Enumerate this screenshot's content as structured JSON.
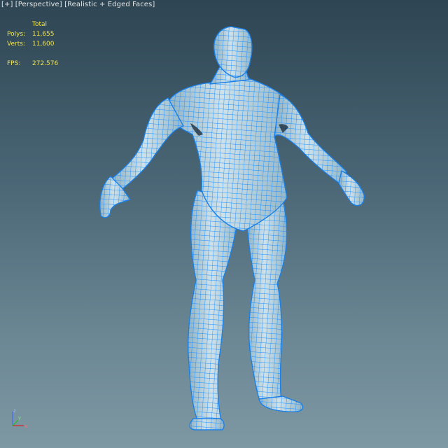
{
  "viewport": {
    "label_plus": "[+]",
    "label_view": "[Perspective]",
    "label_shading": "[Realistic + Edged Faces]"
  },
  "stats": {
    "column_header": "Total",
    "polys_label": "Polys:",
    "polys_value": "11,655",
    "verts_label": "Verts:",
    "verts_value": "11,600",
    "fps_label": "FPS:",
    "fps_value": "272.576"
  },
  "axis_gizmo": {
    "x_label": "x",
    "y_label": "y",
    "z_label": "z"
  },
  "colors": {
    "mesh_fill": "#b9d4e0",
    "mesh_wire": "#1f8fff",
    "stats_text": "#f0e34a",
    "label_text": "#e6e6e6"
  }
}
